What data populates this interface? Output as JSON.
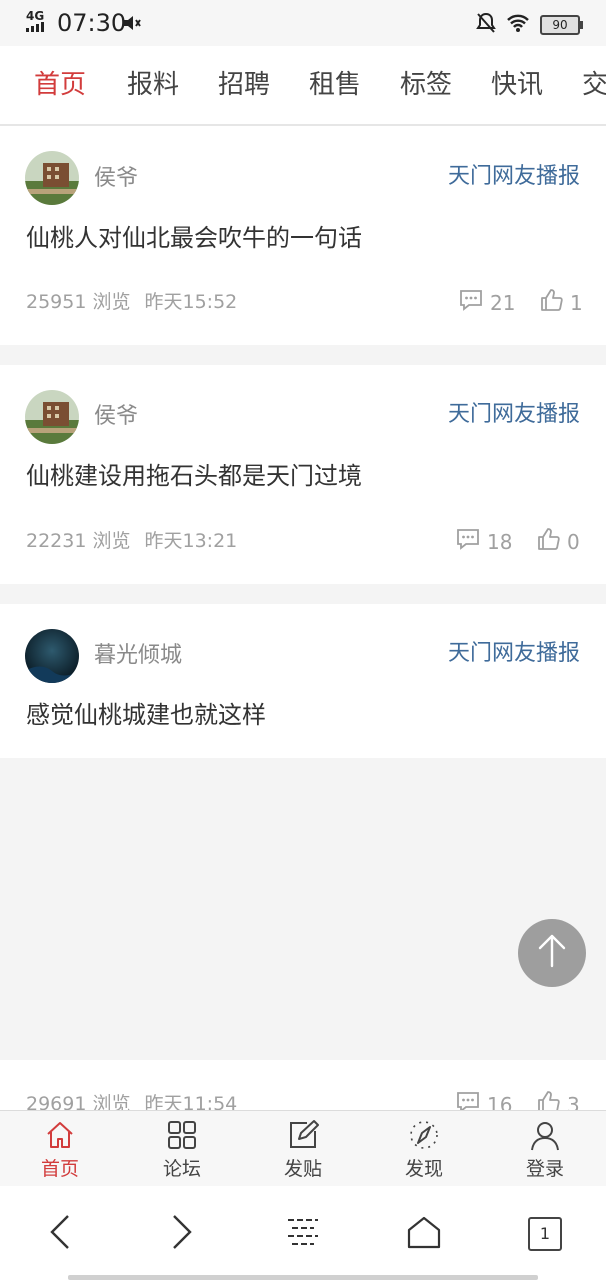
{
  "status_bar": {
    "network": "4G",
    "time": "07:30",
    "battery": "90"
  },
  "tabs": [
    {
      "label": "首页",
      "active": true
    },
    {
      "label": "报料"
    },
    {
      "label": "招聘"
    },
    {
      "label": "租售"
    },
    {
      "label": "标签"
    },
    {
      "label": "快讯"
    },
    {
      "label": "交"
    }
  ],
  "posts": [
    {
      "author": "侯爷",
      "source": "天门网友播报",
      "title": "仙桃人对仙北最会吹牛的一句话",
      "views": "25951 浏览",
      "time": "昨天15:52",
      "comments": "21",
      "likes": "1"
    },
    {
      "author": "侯爷",
      "source": "天门网友播报",
      "title": "仙桃建设用拖石头都是天门过境",
      "views": "22231 浏览",
      "time": "昨天13:21",
      "comments": "18",
      "likes": "0"
    },
    {
      "author": "暮光倾城",
      "source": "天门网友播报",
      "title": "感觉仙桃城建也就这样",
      "views": "29691 浏览",
      "time": "昨天11:54",
      "comments": "16",
      "likes": "3"
    }
  ],
  "bottom_nav": [
    {
      "label": "首页",
      "icon": "home-icon"
    },
    {
      "label": "论坛",
      "icon": "grid-icon"
    },
    {
      "label": "发贴",
      "icon": "edit-icon"
    },
    {
      "label": "发现",
      "icon": "compass-icon"
    },
    {
      "label": "登录",
      "icon": "user-icon"
    }
  ],
  "browser": {
    "tab_count": "1"
  },
  "colors": {
    "accent": "#d23c3c",
    "source_link": "#3f6b9a"
  }
}
